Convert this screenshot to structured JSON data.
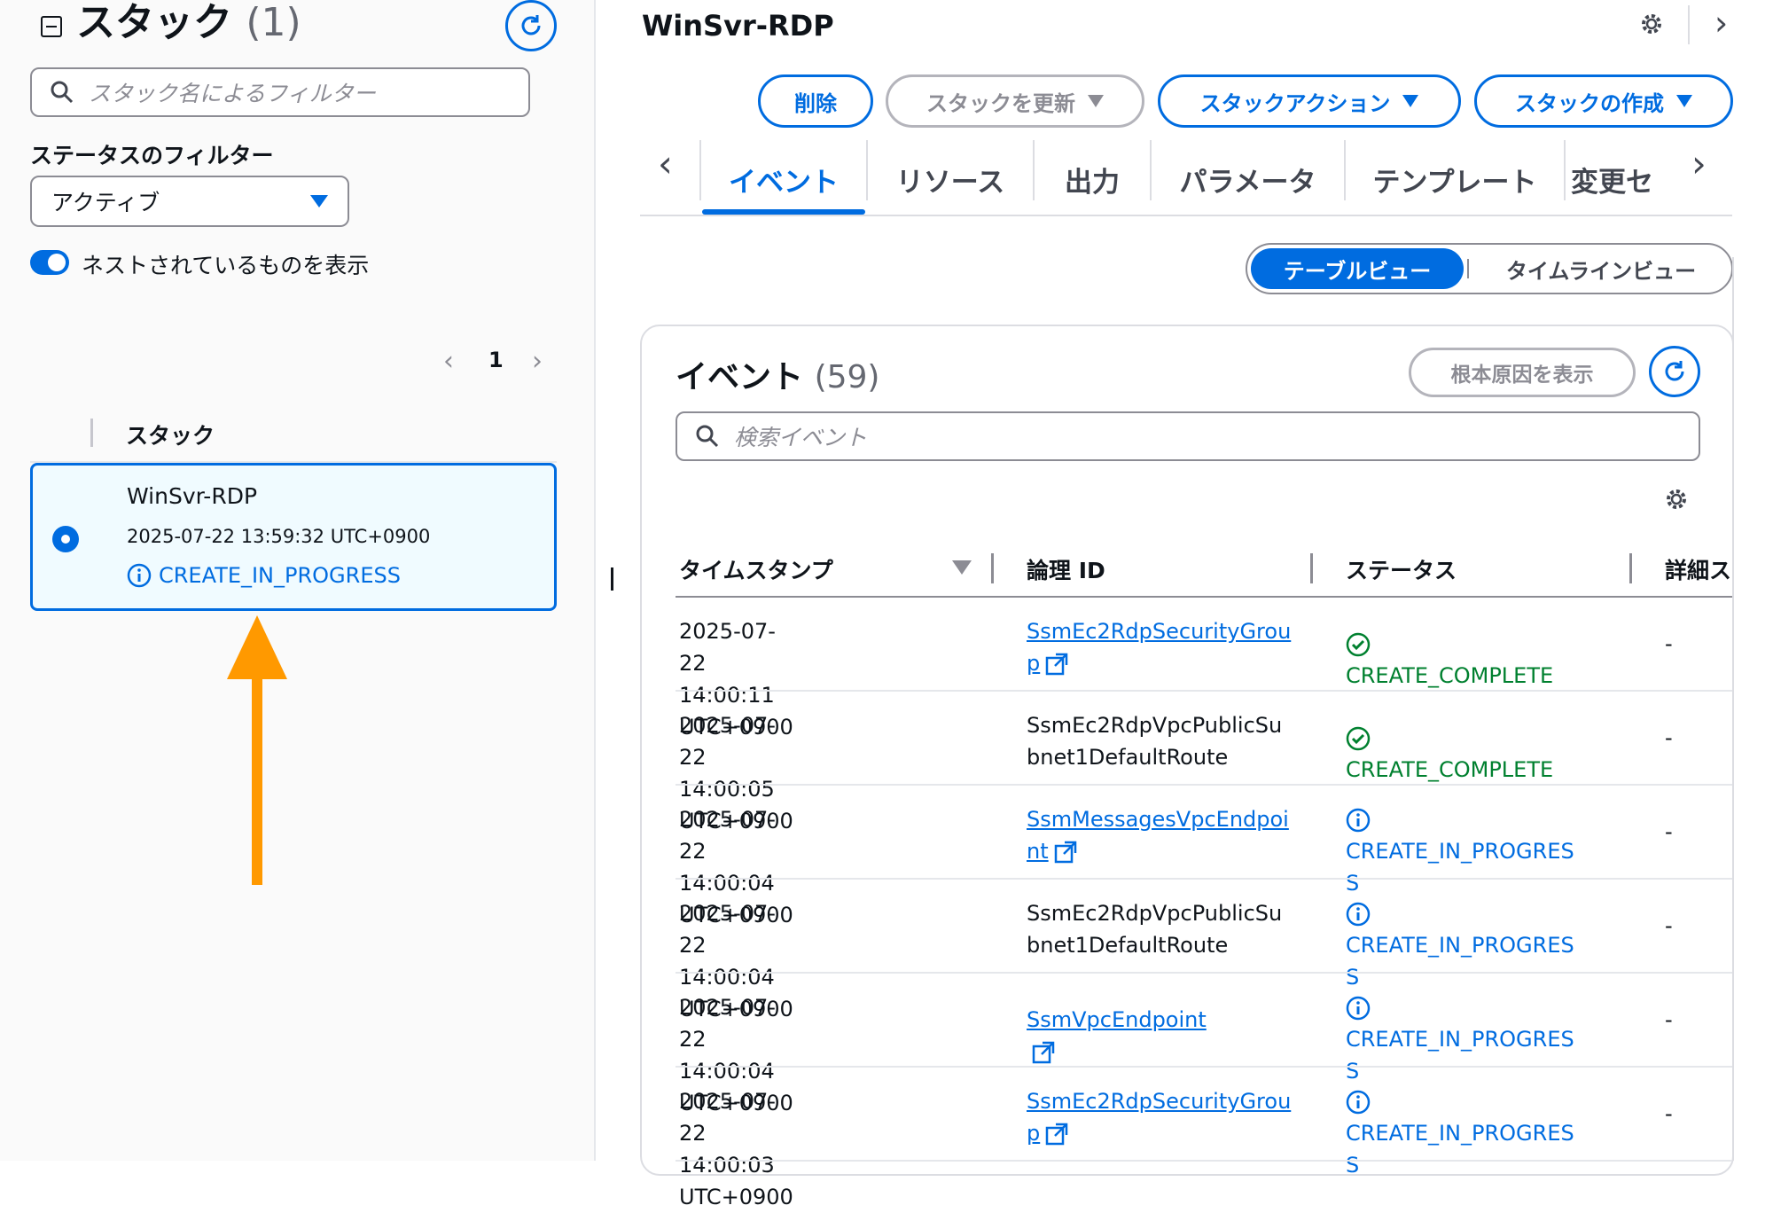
{
  "left": {
    "title": "スタック",
    "count": "(1)",
    "search_placeholder": "スタック名によるフィルター",
    "status_filter_label": "ステータスのフィルター",
    "status_filter_value": "アクティブ",
    "nested_toggle_label": "ネストされているものを表示",
    "page_number": "1",
    "column_header": "スタック",
    "stack": {
      "name": "WinSvr-RDP",
      "created": "2025-07-22 13:59:32 UTC+0900",
      "status": "CREATE_IN_PROGRESS"
    }
  },
  "main": {
    "title": "WinSvr-RDP",
    "buttons": {
      "delete": "削除",
      "update": "スタックを更新",
      "actions": "スタックアクション",
      "create": "スタックの作成"
    },
    "tabs": [
      "イベント",
      "リソース",
      "出力",
      "パラメータ",
      "テンプレート",
      "変更セ"
    ],
    "view_toggle": {
      "table": "テーブルビュー",
      "timeline": "タイムラインビュー"
    },
    "events": {
      "title": "イベント",
      "count": "(59)",
      "root_cause_button": "根本原因を表示",
      "search_placeholder": "検索イベント",
      "columns": {
        "timestamp": "タイムスタンプ",
        "logical_id": "論理 ID",
        "status": "ステータス",
        "detail": "詳細ス"
      },
      "rows": [
        {
          "ts1": "2025-07-22 14:00:11",
          "ts2": "UTC+0900",
          "id1": "SsmEc2RdpSecurityGrou",
          "id2": "p",
          "status1": "CREATE_COMPLETE",
          "status2": "",
          "detail": "-"
        },
        {
          "ts1": "2025-07-22 14:00:05",
          "ts2": "UTC+0900",
          "id1": "SsmEc2RdpVpcPublicSu",
          "id2": "bnet1DefaultRoute",
          "status1": "CREATE_COMPLETE",
          "status2": "",
          "detail": "-"
        },
        {
          "ts1": "2025-07-22 14:00:04",
          "ts2": "UTC+0900",
          "id1": "SsmMessagesVpcEndpoi",
          "id2": "nt",
          "status1": "CREATE_IN_PROGRES",
          "status2": "S",
          "detail": "-"
        },
        {
          "ts1": "2025-07-22 14:00:04",
          "ts2": "UTC+0900",
          "id1": "SsmEc2RdpVpcPublicSu",
          "id2": "bnet1DefaultRoute",
          "status1": "CREATE_IN_PROGRES",
          "status2": "S",
          "detail": "-"
        },
        {
          "ts1": "2025-07-22 14:00:04",
          "ts2": "UTC+0900",
          "id1": "SsmVpcEndpoint",
          "id2": "",
          "status1": "CREATE_IN_PROGRES",
          "status2": "S",
          "detail": "-"
        },
        {
          "ts1": "2025-07-22 14:00:03",
          "ts2": "UTC+0900",
          "id1": "SsmEc2RdpSecurityGrou",
          "id2": "p",
          "status1": "CREATE_IN_PROGRES",
          "status2": "S",
          "detail": "-"
        }
      ]
    }
  },
  "colors": {
    "accent": "#006ce0",
    "success": "#00802f",
    "annotation_arrow": "#ff9900",
    "selected_bg": "#f0fbff"
  }
}
